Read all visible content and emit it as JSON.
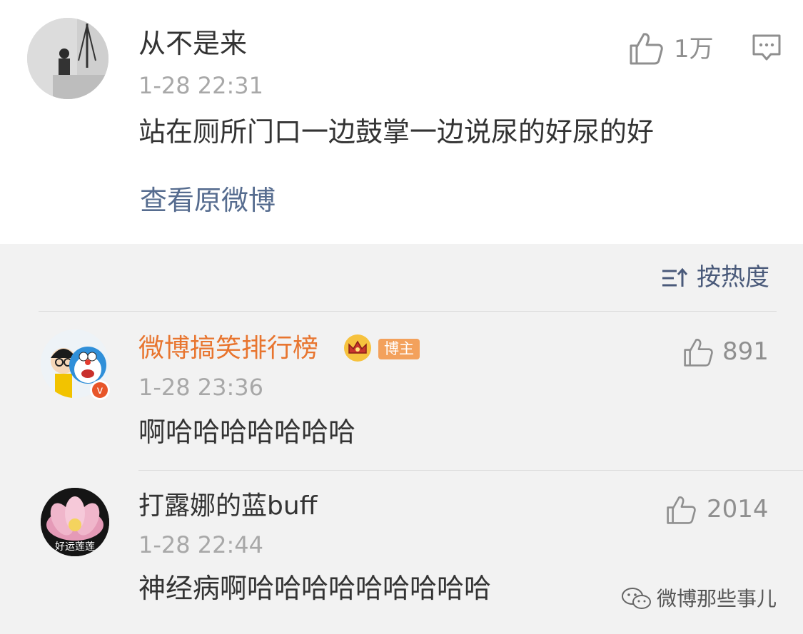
{
  "top_comment": {
    "username": "从不是来",
    "timestamp": "1-28 22:31",
    "likes": "1万",
    "text": "站在厕所门口一边鼓掌一边说尿的好尿的好",
    "view_original_label": "查看原微博"
  },
  "sort": {
    "label": "按热度"
  },
  "replies": [
    {
      "username": "微博搞笑排行榜",
      "badge": "博主",
      "timestamp": "1-28 23:36",
      "likes": "891",
      "text": "啊哈哈哈哈哈哈哈"
    },
    {
      "username": "打露娜的蓝buff",
      "avatar_caption": "好运莲莲",
      "timestamp": "1-28 22:44",
      "likes": "2014",
      "text": "神经病啊哈哈哈哈哈哈哈哈哈"
    }
  ],
  "watermark": {
    "text": "微博那些事儿"
  },
  "colors": {
    "username_highlight": "#e8752f",
    "link": "#566c8f",
    "badge": "#f3a15c",
    "verified": "#e8562a"
  }
}
